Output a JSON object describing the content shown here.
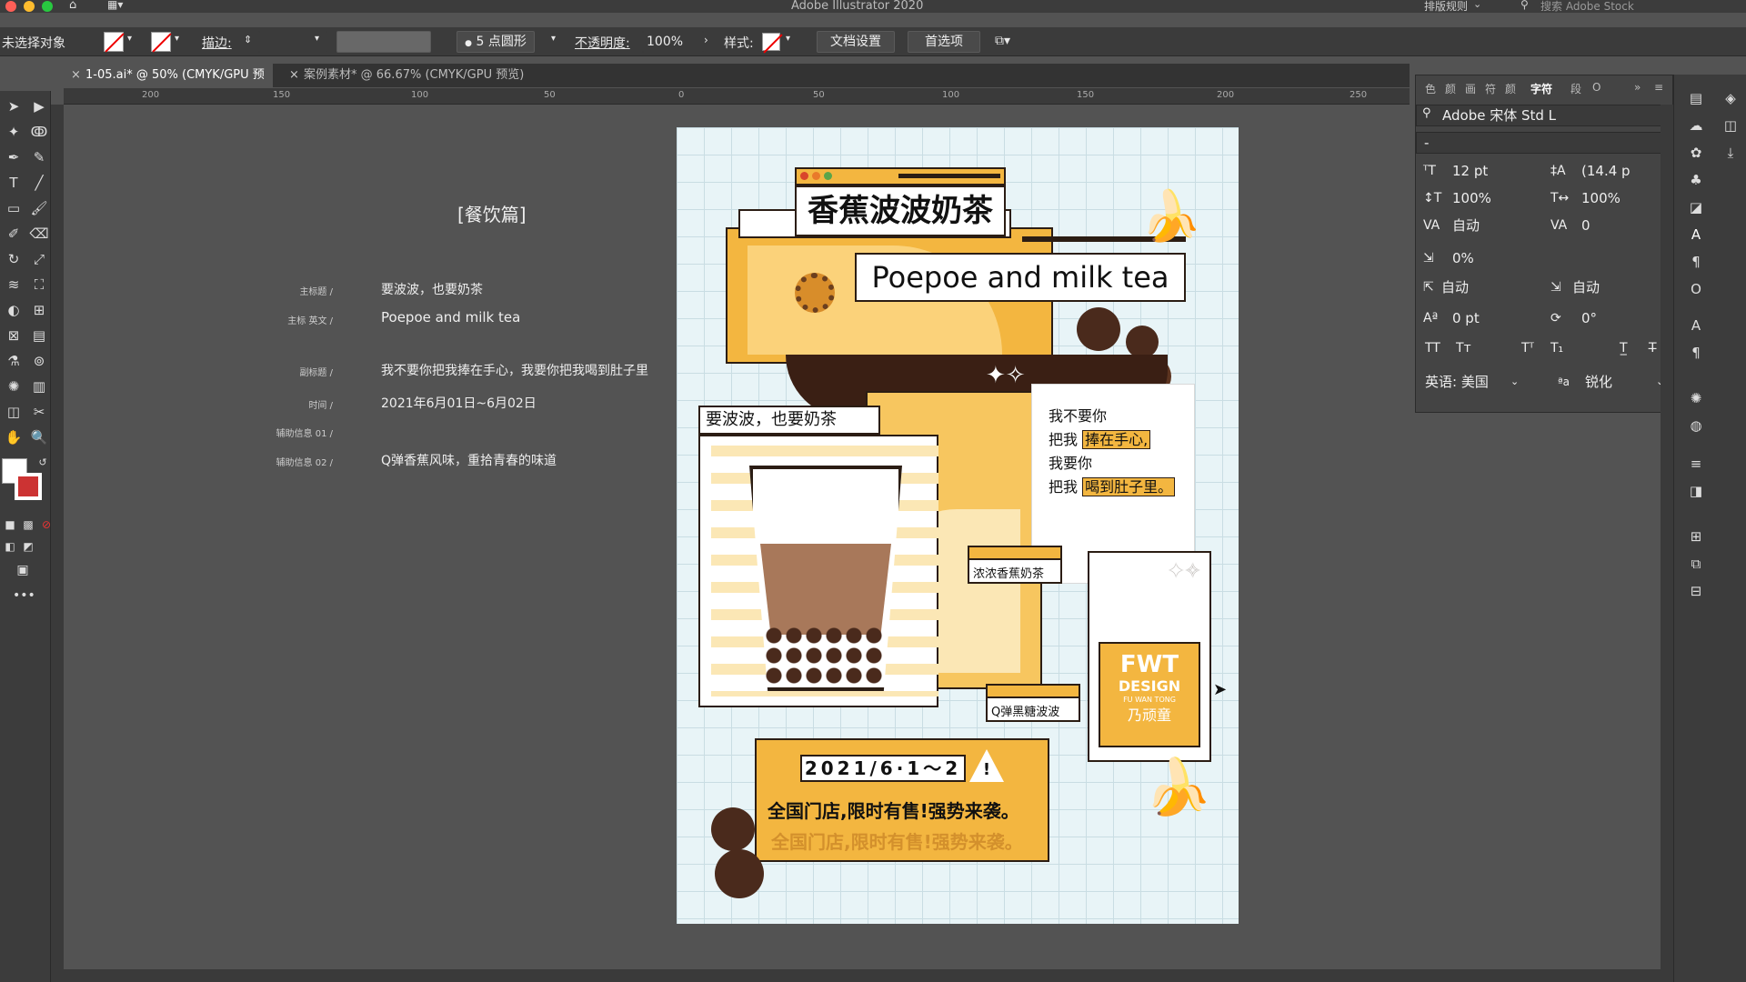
{
  "app": {
    "title": "Adobe Illustrator 2020"
  },
  "menubar": {
    "layout_rule": "排版规则",
    "search_stock": "搜索 Adobe Stock"
  },
  "options": {
    "no_selection": "未选择对象",
    "stroke_label": "描边:",
    "brush": "5 点圆形",
    "opacity_label": "不透明度:",
    "opacity_value": "100%",
    "style_label": "样式:",
    "doc_setup": "文档设置",
    "preferences": "首选项"
  },
  "tabs": [
    {
      "label": "1-05.ai* @ 50% (CMYK/GPU 预览)"
    },
    {
      "label": "案例素材* @ 66.67% (CMYK/GPU 预览)"
    }
  ],
  "ruler": {
    "ticks": [
      "200",
      "150",
      "100",
      "50",
      "0",
      "50",
      "100",
      "150",
      "200",
      "250"
    ]
  },
  "left_text": {
    "heading": "[餐饮篇]",
    "rows": [
      {
        "label": "主标题 /",
        "value": "要波波，也要奶茶"
      },
      {
        "label": "主标 英文 /",
        "value": "Poepoe and milk tea"
      },
      {
        "label": "副标题 /",
        "value": "我不要你把我捧在手心，我要你把我喝到肚子里"
      },
      {
        "label": "时间 /",
        "value": "2021年6月01日~6月02日"
      },
      {
        "label": "辅助信息 01 /",
        "value": ""
      },
      {
        "label": "辅助信息 02 /",
        "value": "Q弹香蕉风味，重拾青春的味道"
      }
    ]
  },
  "poster": {
    "title_cn": "香蕉波波奶茶",
    "title_en": "Poepoe and milk tea",
    "sub_tag": "要波波，也要奶茶",
    "right_lines": [
      "我不要你",
      "把我",
      "捧在手心,",
      "我要你",
      "把我",
      "喝到肚子里。"
    ],
    "label_banana": "浓浓香蕉奶茶",
    "label_boba": "Q弹黑糖波波",
    "date": "2021/6·1～2",
    "promo": "全国门店,限时有售!强势来袭。",
    "promo_shadow": "全国门店,限时有售!强势来袭。",
    "logo_line1": "FWT",
    "logo_line2": "DESIGN",
    "logo_line3": "FU WAN TONG",
    "logo_line4": "乃顽童"
  },
  "char_panel": {
    "tabs": [
      "色",
      "颜",
      "画",
      "符",
      "颜",
      "字符",
      "段",
      "O"
    ],
    "font_family": "Adobe 宋体 Std L",
    "font_style": "-",
    "font_size": "12 pt",
    "leading": "(14.4 p",
    "v_scale": "100%",
    "h_scale": "100%",
    "kerning": "自动",
    "tracking": "0",
    "tsume": "0%",
    "aki_left": "自动",
    "aki_right": "自动",
    "baseline": "0 pt",
    "rotation": "0°",
    "language": "英语: 美国",
    "antialias": "锐化"
  },
  "colors": {
    "accent": "#f0b13c",
    "dark": "#2b1d14",
    "cream": "#fbe7b5",
    "chocolate": "#4a2a1c"
  }
}
